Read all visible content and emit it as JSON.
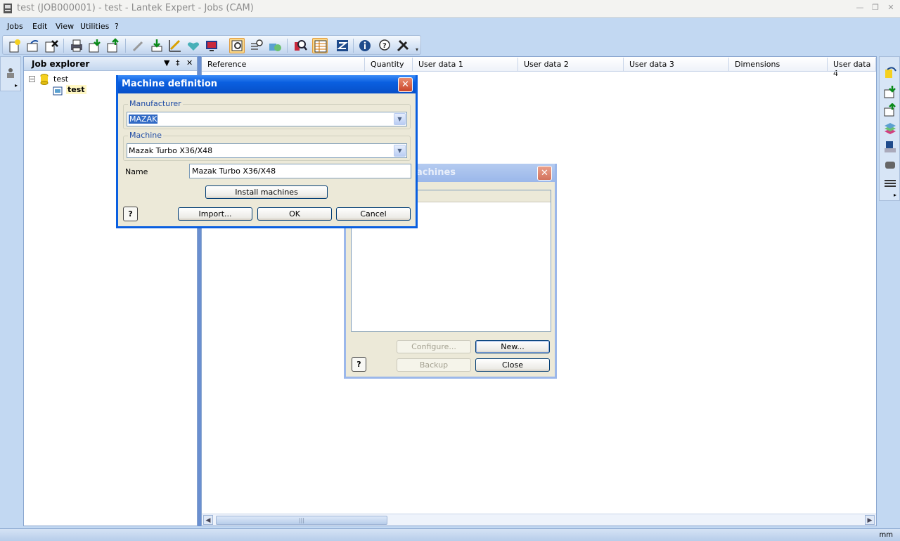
{
  "window": {
    "title": "test (JOB000001) - test - Lantek Expert - Jobs (CAM)"
  },
  "menu": [
    "Jobs",
    "Edit",
    "View",
    "Utilities",
    "?"
  ],
  "toolbar": {
    "icons": [
      "new-job-icon",
      "open-job-icon",
      "delete-job-icon",
      "print-icon",
      "import-icon",
      "export-icon",
      "edit-icon",
      "download-icon",
      "measure-icon",
      "heart-icon",
      "screen-icon",
      "preview-icon",
      "list-zoom-icon",
      "parts-icon",
      "search-icon",
      "grid-view-icon",
      "machine-icon",
      "info-icon",
      "help-icon",
      "tools-icon"
    ]
  },
  "job_explorer": {
    "title": "Job explorer",
    "tree": [
      {
        "label": "test"
      },
      {
        "label": "test"
      }
    ]
  },
  "grid": {
    "columns": [
      "Reference",
      "Quantity",
      "User data 1",
      "User data 2",
      "User data 3",
      "Dimensions",
      "User data 4"
    ]
  },
  "machine_definition": {
    "title": "Machine definition",
    "manufacturer_label": "Manufacturer",
    "manufacturer_value": "MAZAK",
    "machine_label": "Machine",
    "machine_value": "Mazak Turbo X36/X48",
    "name_label": "Name",
    "name_value": "Mazak Turbo X36/X48",
    "install_label": "Install machines",
    "import_label": "Import...",
    "ok_label": "OK",
    "cancel_label": "Cancel",
    "help_glyph": "?"
  },
  "machines_dialog": {
    "title_visible": "achines",
    "configure_label": "Configure...",
    "new_label": "New...",
    "backup_label": "Backup",
    "close_label": "Close",
    "help_glyph": "?"
  },
  "status": {
    "unit": "mm"
  },
  "colors": {
    "title_active": "#0a5fe0",
    "title_inactive": "#9bb7ea",
    "accent": "#316ac5"
  }
}
